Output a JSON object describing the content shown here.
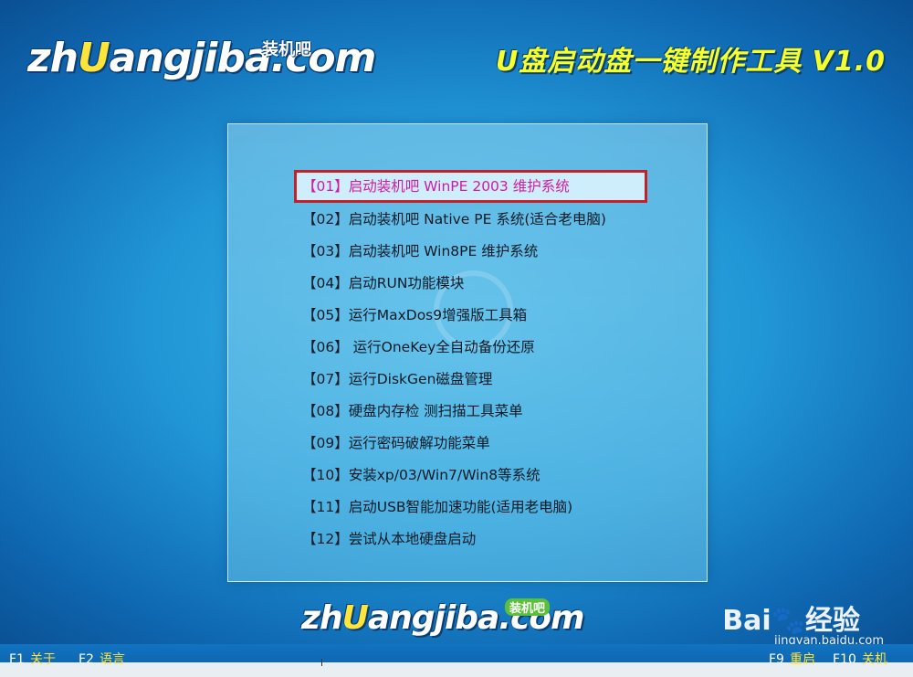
{
  "header": {
    "logo_text_pre": "zh",
    "logo_text_accent": "U",
    "logo_text_post": "angjiba.com",
    "logo_tag": "装机吧",
    "title": "U盘启动盘一键制作工具 V1.0"
  },
  "menu": {
    "items": [
      {
        "label": "【01】启动装机吧 WinPE 2003 维护系统",
        "selected": true
      },
      {
        "label": "【02】启动装机吧 Native PE 系统(适合老电脑)"
      },
      {
        "label": "【03】启动装机吧 Win8PE 维护系统"
      },
      {
        "label": "【04】启动RUN功能模块"
      },
      {
        "label": "【05】运行MaxDos9增强版工具箱"
      },
      {
        "label": "【06】 运行OneKey全自动备份还原"
      },
      {
        "label": "【07】运行DiskGen磁盘管理"
      },
      {
        "label": "【08】硬盘内存检 测扫描工具菜单"
      },
      {
        "label": "【09】运行密码破解功能菜单"
      },
      {
        "label": "【10】安装xp/03/Win7/Win8等系统"
      },
      {
        "label": "【11】启动USB智能加速功能(适用老电脑)"
      },
      {
        "label": "【12】尝试从本地硬盘启动"
      }
    ]
  },
  "footer": {
    "logo_tag": "装机吧",
    "watermark_brand": "Bai",
    "watermark_paw": "🐾",
    "watermark_brand2": "经验",
    "watermark_url": "jingyan.baidu.com"
  },
  "statusbar": {
    "f1_key": "F1",
    "f1_label": "关于",
    "f2_key": "F2",
    "f2_label": "语言",
    "f9_key": "F9",
    "f9_label": "重启",
    "f10_key": "F10",
    "f10_label": "关机"
  },
  "colors": {
    "selected_text": "#d21aa6",
    "selected_outline": "#c4202a",
    "title_yellow": "#f4ff2b"
  }
}
